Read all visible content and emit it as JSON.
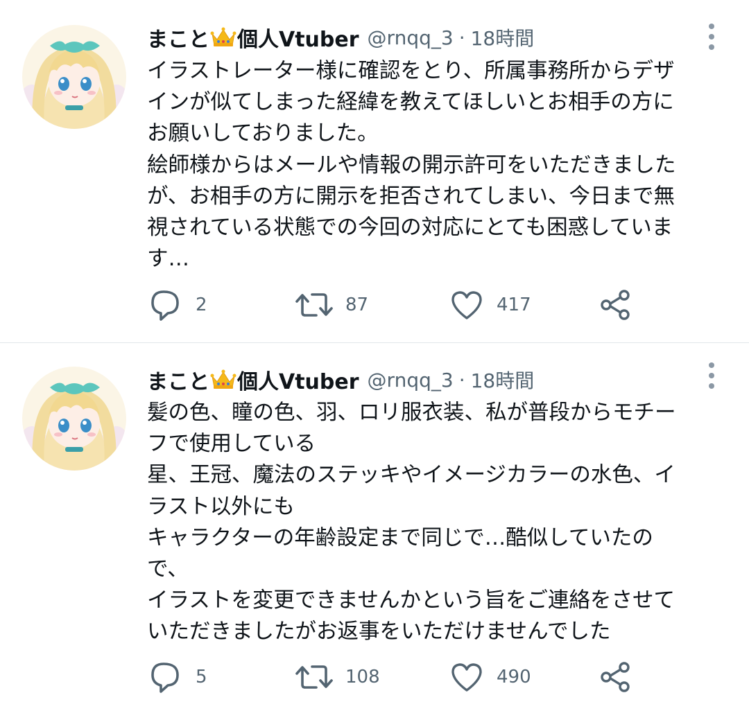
{
  "tweets": [
    {
      "author": {
        "name": "まこと",
        "badge_icon": "crown-emoji",
        "suffix": "個人Vtuber",
        "handle": "@rnqq_3"
      },
      "separator": "·",
      "time": "18時間",
      "lines": [
        "イラストレーター様に確認をとり、所属事務所からデザ",
        "インが似てしまった経緯を教えてほしいとお相手の方に",
        "お願いしておりました。",
        "絵師様からはメールや情報の開示許可をいただきました",
        "が、お相手の方に開示を拒否されてしまい、今日まで無",
        "視されている状態での今回の対応にとても困惑していま",
        "す…"
      ],
      "actions": {
        "replies": "2",
        "retweets": "87",
        "likes": "417"
      }
    },
    {
      "author": {
        "name": "まこと",
        "badge_icon": "crown-emoji",
        "suffix": "個人Vtuber",
        "handle": "@rnqq_3"
      },
      "separator": "·",
      "time": "18時間",
      "lines": [
        "髪の色、瞳の色、羽、ロリ服衣装、私が普段からモチー",
        "フで使用している",
        "星、王冠、魔法のステッキやイメージカラーの水色、イ",
        "ラスト以外にも",
        "キャラクターの年齢設定まで同じで…酷似していたの",
        "で、",
        "イラストを変更できませんかという旨をご連絡をさせて",
        "いただきましたがお返事をいただけませんでした"
      ],
      "actions": {
        "replies": "5",
        "retweets": "108",
        "likes": "490"
      }
    }
  ],
  "colors": {
    "text": "#0f1419",
    "secondary": "#536471",
    "divider": "#e1e6ea",
    "more_dots": "#8b98a5"
  },
  "icons": {
    "reply": "reply-bubble-icon",
    "retweet": "retweet-arrows-icon",
    "like": "heart-icon",
    "share": "share-nodes-icon",
    "more": "more-vertical-dots-icon"
  }
}
